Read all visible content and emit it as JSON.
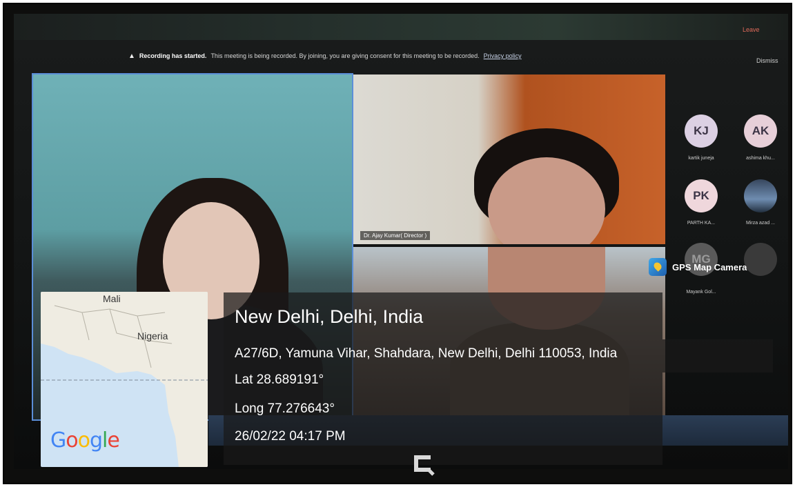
{
  "recording_banner": {
    "title": "Recording has started.",
    "message": "This meeting is being recorded. By joining, you are giving consent for this meeting to be recorded.",
    "privacy_link": "Privacy policy",
    "dismiss": "Dismiss"
  },
  "top_bar": {
    "leave": "Leave"
  },
  "tiles": [
    {
      "name": ""
    },
    {
      "name": "Dr. Ajay Kumar( Director )"
    },
    {
      "name": ""
    }
  ],
  "participants": [
    {
      "initials": "KJ",
      "name": "kartik juneja",
      "avatar_color": "#dcd0e3"
    },
    {
      "initials": "AK",
      "name": "ashima khu...",
      "avatar_color": "#e7cfd8"
    },
    {
      "initials": "PK",
      "name": "PARTH KA...",
      "avatar_color": "#efd7dc"
    },
    {
      "initials": "",
      "name": "Mirza azad ...",
      "avatar_color": "#45586f"
    },
    {
      "initials": "MG",
      "name": "Mayank Gol...",
      "avatar_color": "#5a5a5a"
    },
    {
      "initials": "",
      "name": "",
      "avatar_color": "#3a3a3a"
    }
  ],
  "gps": {
    "app_name": "GPS Map Camera",
    "place": "New Delhi, Delhi, India",
    "address": "A27/6D, Yamuna Vihar, Shahdara, New Delhi, Delhi 110053, India",
    "lat": "Lat 28.689191°",
    "long": "Long 77.276643°",
    "datetime": "26/02/22 04:17 PM"
  },
  "map": {
    "labels": {
      "mali": "Mali",
      "nigeria": "Nigeria"
    },
    "google_letters": [
      "G",
      "o",
      "o",
      "g",
      "l",
      "e"
    ]
  },
  "colors": {
    "tile_active_border": "#5b8ed8",
    "info_bg": "rgba(25,25,25,0.72)"
  }
}
